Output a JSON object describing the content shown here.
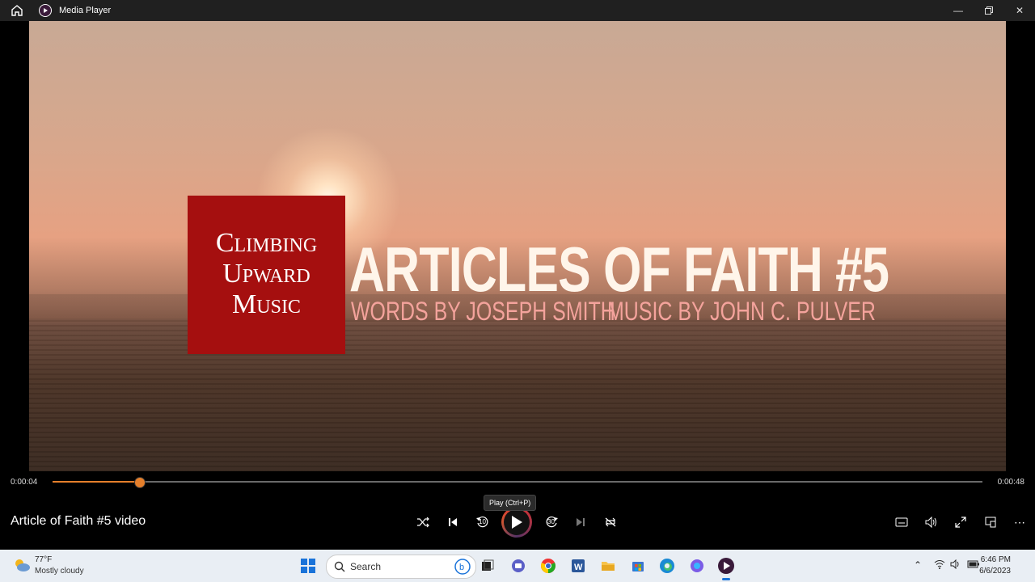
{
  "window": {
    "title": "Media Player",
    "controls": [
      "minimize-icon",
      "restore-icon",
      "close-icon"
    ]
  },
  "video": {
    "logo_lines": [
      "Climbing",
      "Upward",
      "Music"
    ],
    "title_text": "ARTICLES OF FAITH #5",
    "words_credit": "WORDS BY JOSEPH SMITH",
    "music_credit": "MUSIC BY JOHN C. PULVER",
    "logo_color": "#a50f0f",
    "title_color": "#fff5ea",
    "credit_color": "#f4a39c"
  },
  "playback": {
    "current_time": "0:00:04",
    "total_time": "0:00:48",
    "progress_fraction": 0.093,
    "accent_color": "#e57f2b",
    "media_title": "Article of Faith #5 video",
    "tooltip": "Play (Ctrl+P)",
    "skip_back_seconds": "10",
    "skip_forward_seconds": "30"
  },
  "taskbar": {
    "weather_temp": "77°F",
    "weather_condition": "Mostly cloudy",
    "search_label": "Search",
    "time": "6:46 PM",
    "date": "6/6/2023",
    "pinned_apps": [
      "bing-icon",
      "task-view-icon",
      "teams-chat-icon",
      "chrome-icon",
      "word-icon",
      "file-explorer-icon",
      "store-icon",
      "edge-icon",
      "copilot-icon",
      "media-player-icon"
    ]
  }
}
